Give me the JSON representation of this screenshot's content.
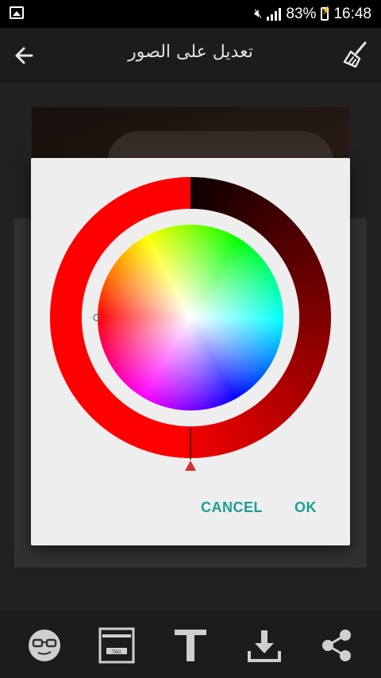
{
  "status_bar": {
    "battery": "83%",
    "time": "16:48"
  },
  "app_bar": {
    "title": "تعديل على الصور",
    "back_icon": "arrow-left-icon",
    "clear_icon": "broom-icon"
  },
  "color_picker": {
    "selected_color": "#ff0000",
    "hue_degrees": 0,
    "saturation": 1.0,
    "value": 1.0,
    "cancel_label": "CANCEL",
    "ok_label": "OK",
    "accent_color": "#1b9e90"
  },
  "bottom_bar": {
    "items": [
      "emoji-glasses-icon",
      "sticker-frame-icon",
      "text-icon",
      "download-icon",
      "share-icon"
    ]
  }
}
